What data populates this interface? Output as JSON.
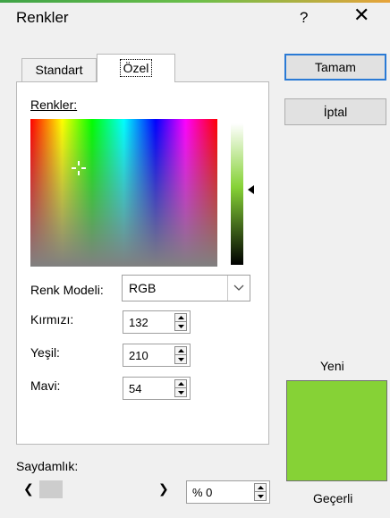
{
  "window": {
    "title": "Renkler",
    "help": "?",
    "close": "✕"
  },
  "tabs": [
    {
      "label": "Standart"
    },
    {
      "label": "Özel"
    }
  ],
  "buttons": {
    "ok": "Tamam",
    "cancel": "İptal"
  },
  "colors_label": "Renkler:",
  "model": {
    "label": "Renk Modeli:",
    "value": "RGB"
  },
  "rgb": {
    "red": {
      "label": "Kırmızı:",
      "value": "132"
    },
    "green": {
      "label": "Yeşil:",
      "value": "210"
    },
    "blue": {
      "label": "Mavi:",
      "value": "54"
    }
  },
  "preview": {
    "new_label": "Yeni",
    "current_label": "Geçerli",
    "new_color": "#86d236"
  },
  "transparency": {
    "label": "Saydamlık:",
    "value": "% 0"
  }
}
